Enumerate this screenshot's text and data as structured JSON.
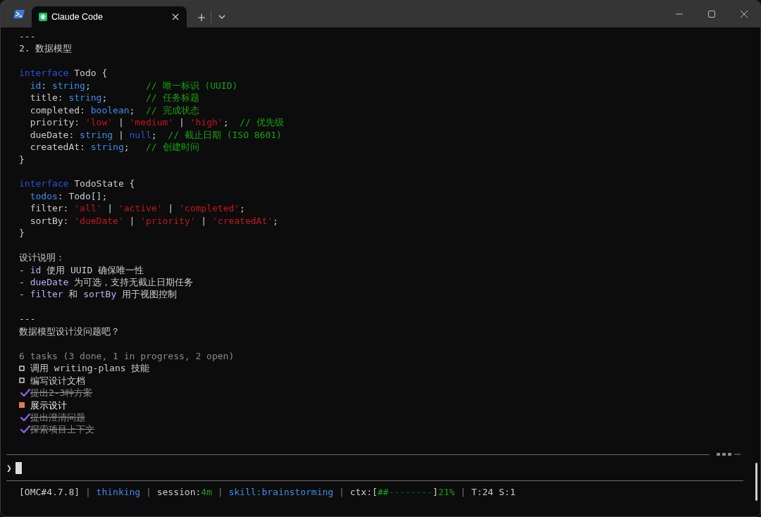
{
  "window": {
    "tab": {
      "title": "Claude Code",
      "selected": true
    }
  },
  "transcript": [
    [
      [
        {
          "kind": "text",
          "text": "---"
        }
      ],
      [
        {
          "kind": "text",
          "text": "2. 数据模型"
        }
      ]
    ],
    [
      [
        {
          "kind": "keyword",
          "text": "interface"
        },
        {
          "kind": "text",
          "text": " Todo {"
        }
      ],
      [
        {
          "kind": "type",
          "text": "  id"
        },
        {
          "kind": "text",
          "text": ": "
        },
        {
          "kind": "type",
          "text": "string"
        },
        {
          "kind": "text",
          "text": ";          "
        },
        {
          "kind": "comment",
          "text": "// 唯一标识 (UUID)"
        }
      ],
      [
        {
          "kind": "text",
          "text": "  title: "
        },
        {
          "kind": "type",
          "text": "string"
        },
        {
          "kind": "text",
          "text": ";       "
        },
        {
          "kind": "comment",
          "text": "// 任务标题"
        }
      ],
      [
        {
          "kind": "text",
          "text": "  completed: "
        },
        {
          "kind": "type",
          "text": "boolean"
        },
        {
          "kind": "text",
          "text": ";  "
        },
        {
          "kind": "comment",
          "text": "// 完成状态"
        }
      ],
      [
        {
          "kind": "text",
          "text": "  priority: "
        },
        {
          "kind": "string",
          "text": "'low'"
        },
        {
          "kind": "text",
          "text": " | "
        },
        {
          "kind": "string",
          "text": "'medium'"
        },
        {
          "kind": "text",
          "text": " | "
        },
        {
          "kind": "string",
          "text": "'high'"
        },
        {
          "kind": "text",
          "text": ";  "
        },
        {
          "kind": "comment",
          "text": "// 优先级"
        }
      ],
      [
        {
          "kind": "text",
          "text": "  dueDate: "
        },
        {
          "kind": "type",
          "text": "string"
        },
        {
          "kind": "text",
          "text": " | "
        },
        {
          "kind": "keyword",
          "text": "null"
        },
        {
          "kind": "text",
          "text": ";  "
        },
        {
          "kind": "comment",
          "text": "// 截止日期 (ISO 8601)"
        }
      ],
      [
        {
          "kind": "text",
          "text": "  createdAt: "
        },
        {
          "kind": "type",
          "text": "string"
        },
        {
          "kind": "text",
          "text": ";   "
        },
        {
          "kind": "comment",
          "text": "// 创建时间"
        }
      ],
      [
        {
          "kind": "text",
          "text": "}"
        }
      ]
    ],
    [
      [
        {
          "kind": "keyword",
          "text": "interface"
        },
        {
          "kind": "text",
          "text": " TodoState {"
        }
      ],
      [
        {
          "kind": "type",
          "text": "  todos"
        },
        {
          "kind": "text",
          "text": ": Todo[];"
        }
      ],
      [
        {
          "kind": "text",
          "text": "  filter: "
        },
        {
          "kind": "string",
          "text": "'all'"
        },
        {
          "kind": "text",
          "text": " | "
        },
        {
          "kind": "string",
          "text": "'active'"
        },
        {
          "kind": "text",
          "text": " | "
        },
        {
          "kind": "string",
          "text": "'completed'"
        },
        {
          "kind": "text",
          "text": ";"
        }
      ],
      [
        {
          "kind": "text",
          "text": "  sortBy: "
        },
        {
          "kind": "string",
          "text": "'dueDate'"
        },
        {
          "kind": "text",
          "text": " | "
        },
        {
          "kind": "string",
          "text": "'priority'"
        },
        {
          "kind": "text",
          "text": " | "
        },
        {
          "kind": "string",
          "text": "'createdAt'"
        },
        {
          "kind": "text",
          "text": ";"
        }
      ],
      [
        {
          "kind": "text",
          "text": "}"
        }
      ]
    ],
    [
      [
        {
          "kind": "text",
          "text": "设计说明："
        }
      ],
      [
        {
          "kind": "text",
          "text": "- "
        },
        {
          "kind": "code",
          "text": "id"
        },
        {
          "kind": "text",
          "text": " 使用 UUID 确保唯一性"
        }
      ],
      [
        {
          "kind": "text",
          "text": "- "
        },
        {
          "kind": "code",
          "text": "dueDate"
        },
        {
          "kind": "text",
          "text": " 为可选，支持无截止日期任务"
        }
      ],
      [
        {
          "kind": "text",
          "text": "- "
        },
        {
          "kind": "code",
          "text": "filter"
        },
        {
          "kind": "text",
          "text": " 和 "
        },
        {
          "kind": "code",
          "text": "sortBy"
        },
        {
          "kind": "text",
          "text": " 用于视图控制"
        }
      ]
    ],
    [
      [
        {
          "kind": "text",
          "text": "---"
        }
      ],
      [
        {
          "kind": "text",
          "text": "数据模型设计没问题吧？"
        }
      ]
    ]
  ],
  "tasks": {
    "summary": "6 tasks (3 done, 1 in progress, 2 open)",
    "items": [
      {
        "done": false,
        "in_progress": false,
        "text": "调用 writing-plans 技能"
      },
      {
        "done": false,
        "in_progress": false,
        "text": "编写设计文档"
      },
      {
        "done": true,
        "in_progress": false,
        "text": "提出2-3种方案"
      },
      {
        "done": false,
        "in_progress": true,
        "text": "展示设计"
      },
      {
        "done": true,
        "in_progress": false,
        "text": "提出澄清问题"
      },
      {
        "done": true,
        "in_progress": false,
        "text": "探索项目上下文"
      }
    ]
  },
  "prompt": {
    "symbol": "❯"
  },
  "status_bar": [
    {
      "kind": "text",
      "text": "[OMC#4.7.8] "
    },
    {
      "kind": "muted",
      "text": "| "
    },
    {
      "kind": "type",
      "text": "thinking"
    },
    {
      "kind": "muted",
      "text": " | "
    },
    {
      "kind": "text",
      "text": "session:"
    },
    {
      "kind": "comment",
      "text": "4m"
    },
    {
      "kind": "muted",
      "text": " | "
    },
    {
      "kind": "type",
      "text": "skill:brainstorming"
    },
    {
      "kind": "muted",
      "text": " | "
    },
    {
      "kind": "text",
      "text": "ctx:["
    },
    {
      "kind": "comment",
      "text": "##"
    },
    {
      "kind": "dark",
      "text": "--------"
    },
    {
      "kind": "text",
      "text": "]"
    },
    {
      "kind": "comment",
      "text": "21%"
    },
    {
      "kind": "muted",
      "text": " | "
    },
    {
      "kind": "text",
      "text": "T:24 S:1"
    }
  ]
}
